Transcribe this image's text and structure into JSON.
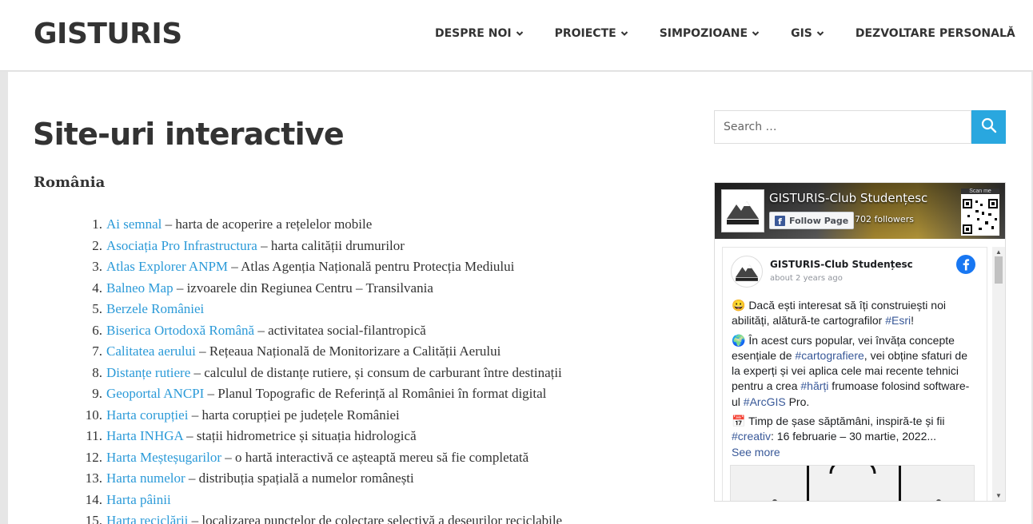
{
  "header": {
    "logo": "GISTURIS",
    "nav": [
      {
        "label": "DESPRE NOI",
        "has_dropdown": true
      },
      {
        "label": "PROIECTE",
        "has_dropdown": true
      },
      {
        "label": "SIMPOZIOANE",
        "has_dropdown": true
      },
      {
        "label": "GIS",
        "has_dropdown": true
      },
      {
        "label": "DEZVOLTARE PERSONALĂ",
        "has_dropdown": false
      }
    ]
  },
  "main": {
    "title": "Site-uri interactive",
    "section_heading": "România",
    "items": [
      {
        "num": "1.",
        "link": "Ai semnal",
        "desc": " – harta de acoperire a rețelelor mobile"
      },
      {
        "num": "2.",
        "link": "Asociația Pro Infrastructura",
        "desc": " – harta calității drumurilor"
      },
      {
        "num": "3.",
        "link": "Atlas Explorer ANPM",
        "desc": " – Atlas Agenția Națională pentru Protecția Mediului"
      },
      {
        "num": "4.",
        "link": "Balneo Map",
        "desc": " – izvoarele din Regiunea Centru – Transilvania"
      },
      {
        "num": "5.",
        "link": "Berzele României",
        "desc": ""
      },
      {
        "num": "6.",
        "link": "Biserica Ortodoxă Română",
        "desc": " – activitatea social-filantropică"
      },
      {
        "num": "7.",
        "link": "Calitatea aerului",
        "desc": " – Rețeaua Națională de Monitorizare a Calității Aerului"
      },
      {
        "num": "8.",
        "link": "Distanțe rutiere",
        "desc": " – calculul de distanțe rutiere, și consum de carburant între destinații"
      },
      {
        "num": "9.",
        "link": "Geoportal ANCPI",
        "desc": " – Planul Topografic de Referință al României în format digital"
      },
      {
        "num": "10.",
        "link": "Harta corupției",
        "desc": " – harta corupției pe județele României"
      },
      {
        "num": "11.",
        "link": "Harta INHGA",
        "desc": " – stații hidrometrice și situația hidrologică"
      },
      {
        "num": "12.",
        "link": "Harta Meșteșugarilor",
        "desc": " – o hartă interactivă ce așteaptă mereu să fie completată"
      },
      {
        "num": "13.",
        "link": "Harta numelor",
        "desc": " – distribuția spațială a numelor românești"
      },
      {
        "num": "14.",
        "link": "Harta pâinii",
        "desc": ""
      },
      {
        "num": "15.",
        "link": "Harta reciclării",
        "desc": " – localizarea punctelor de colectare selectivă a deșeurilor reciclabile"
      }
    ]
  },
  "sidebar": {
    "search_placeholder": "Search …",
    "facebook": {
      "page_name": "GISTURIS-Club Studențesc",
      "follow_label": "Follow Page",
      "followers": "702 followers",
      "scan_label": "Scan me",
      "post": {
        "author": "GISTURIS-Club Studențesc",
        "time": "about 2 years ago",
        "p1_pre": "😀 Dacă ești interesat să îți construiești noi abilități, alătură-te cartografilor ",
        "p1_tag": "#Esri",
        "p1_post": "!",
        "p2_pre": "🌍 În acest curs popular, vei învăța concepte esențiale de ",
        "p2_tag1": "#cartografiere",
        "p2_mid": ", vei obține sfaturi de la experți și vei aplica cele mai recente tehnici pentru a crea ",
        "p2_tag2": "#hărți",
        "p2_mid2": " frumoase folosind software-ul ",
        "p2_tag3": "#ArcGIS",
        "p2_post": " Pro.",
        "p3_pre": "📅 Timp de șase săptămâni, inspiră-te și fii ",
        "p3_tag": "#creativ",
        "p3_post": ": 16 februarie – 30 martie, 2022...",
        "see_more": "See more"
      }
    }
  },
  "colors": {
    "link": "#2b9ad8",
    "search_button": "#29a7df",
    "facebook_blue": "#1877f2"
  }
}
